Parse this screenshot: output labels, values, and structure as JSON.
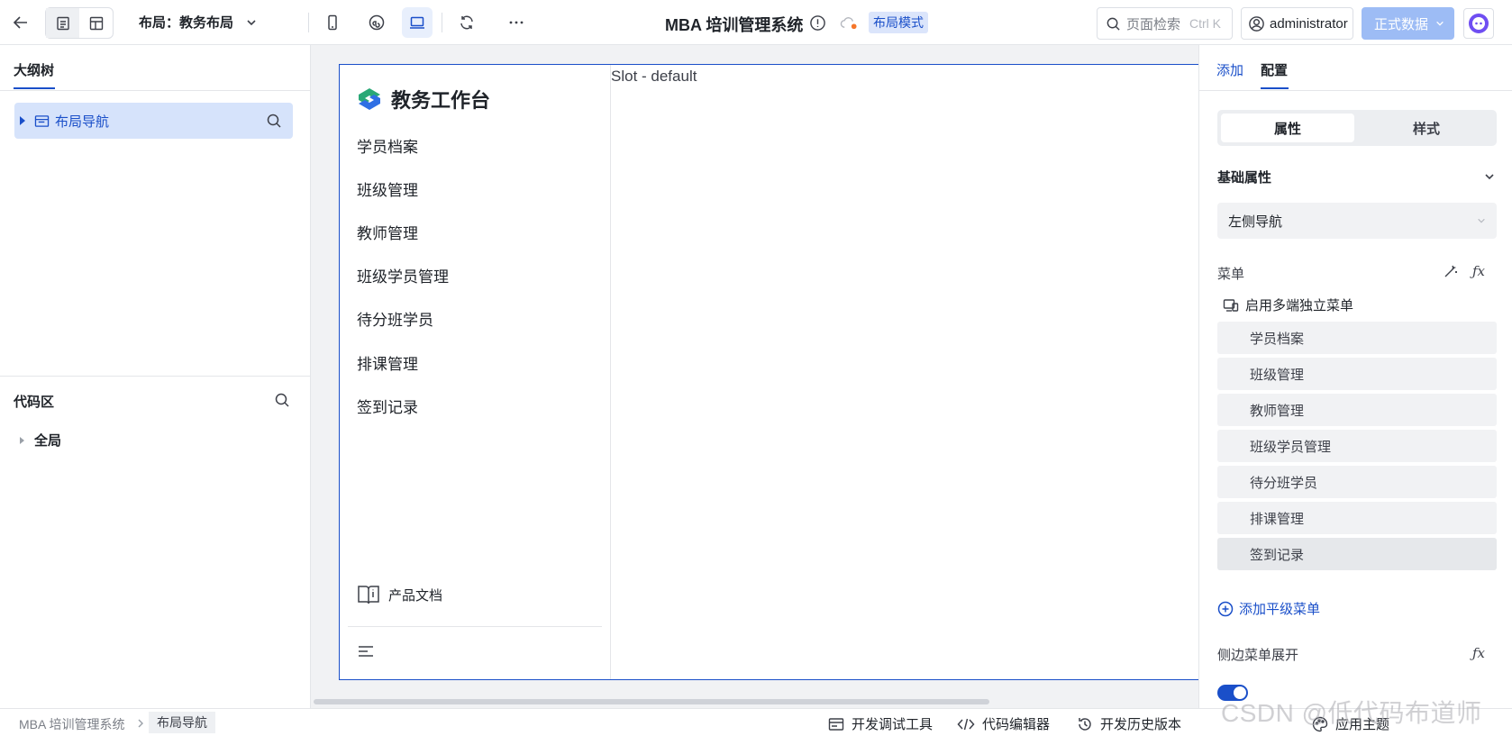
{
  "topbar": {
    "layout_label": "布局：教务布局",
    "app_title": "MBA 培训管理系统",
    "mode_badge": "布局模式",
    "search_placeholder": "页面检索",
    "search_shortcut": "Ctrl K",
    "user": "administrator",
    "data_button": "正式数据"
  },
  "left_panel": {
    "outline_title": "大纲树",
    "outline_item": "布局导航",
    "code_title": "代码区",
    "code_item": "全局"
  },
  "canvas": {
    "brand": "教务工作台",
    "nav_items": [
      "学员档案",
      "班级管理",
      "教师管理",
      "班级学员管理",
      "待分班学员",
      "排课管理",
      "签到记录"
    ],
    "doc_link": "产品文档",
    "slot_label": "Slot - default"
  },
  "right_panel": {
    "tab_add": "添加",
    "tab_config": "配置",
    "seg_props": "属性",
    "seg_style": "样式",
    "basic_title": "基础属性",
    "nav_type": "左侧导航",
    "menu_label": "菜单",
    "multi_terminal": "启用多端独立菜单",
    "menu_items": [
      "学员档案",
      "班级管理",
      "教师管理",
      "班级学员管理",
      "待分班学员",
      "排课管理",
      "签到记录"
    ],
    "add_menu": "添加平级菜单",
    "sidebar_expand": "侧边菜单展开",
    "sidebar_expand_on": true
  },
  "statusbar": {
    "crumb_root": "MBA 培训管理系统",
    "crumb_current": "布局导航",
    "debug_tool": "开发调试工具",
    "code_editor": "代码编辑器",
    "history": "开发历史版本",
    "theme": "应用主题"
  },
  "watermark": "CSDN @低代码布道师",
  "colors": {
    "accent": "#1a4fc9",
    "accent_light": "#d6e3fb",
    "data_button": "#9dbcf5"
  }
}
